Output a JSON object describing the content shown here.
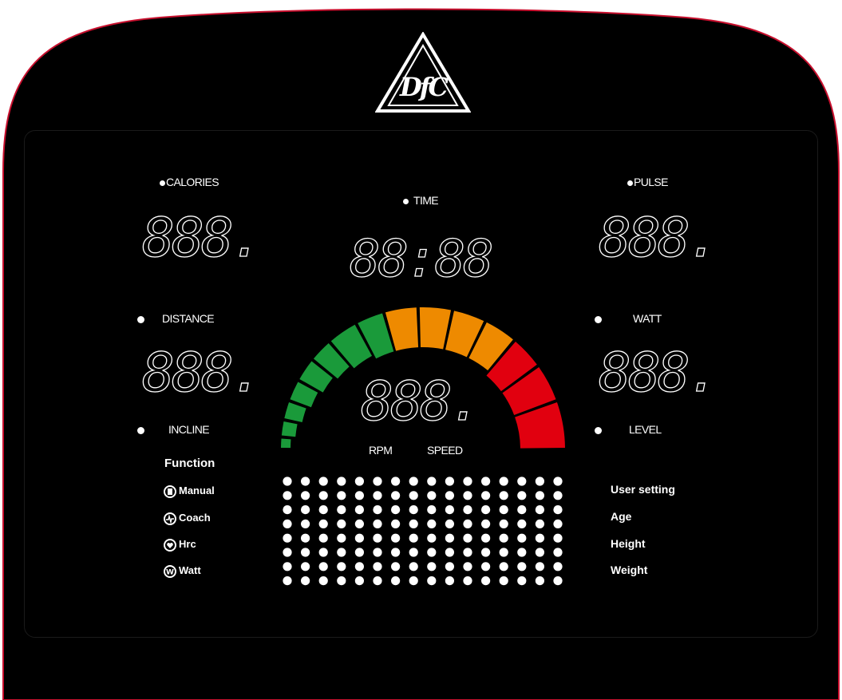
{
  "brand": {
    "logo_text": "DfC"
  },
  "left_panel": {
    "calories_label": "CALORIES",
    "calories_value": "888.",
    "distance_label": "DISTANCE",
    "distance_value": "888.",
    "incline_label": "INCLINE"
  },
  "center_panel": {
    "time_label": "TIME",
    "time_value": "88:88",
    "gauge_value": "888.",
    "rpm_label": "RPM",
    "speed_label": "SPEED",
    "gauge_colors": {
      "low": "#1a9a3a",
      "mid": "#ee8a00",
      "high": "#e1000f"
    }
  },
  "right_panel": {
    "pulse_label": "PULSE",
    "pulse_value": "888.",
    "watt_label": "WATT",
    "watt_value": "888.",
    "level_label": "LEVEL"
  },
  "function_menu": {
    "title": "Function",
    "items": [
      {
        "label": "Manual",
        "icon": "manual-icon"
      },
      {
        "label": "Coach",
        "icon": "coach-icon"
      },
      {
        "label": "Hrc",
        "icon": "heart-icon"
      },
      {
        "label": "Watt",
        "icon": "watt-icon"
      }
    ]
  },
  "user_settings": {
    "title": "User setting",
    "items": [
      "Age",
      "Height",
      "Weight"
    ]
  },
  "matrix": {
    "rows": 8,
    "cols": 16
  },
  "colors": {
    "frame_border": "#c8102e",
    "panel_bg": "#000000",
    "text": "#ffffff"
  }
}
